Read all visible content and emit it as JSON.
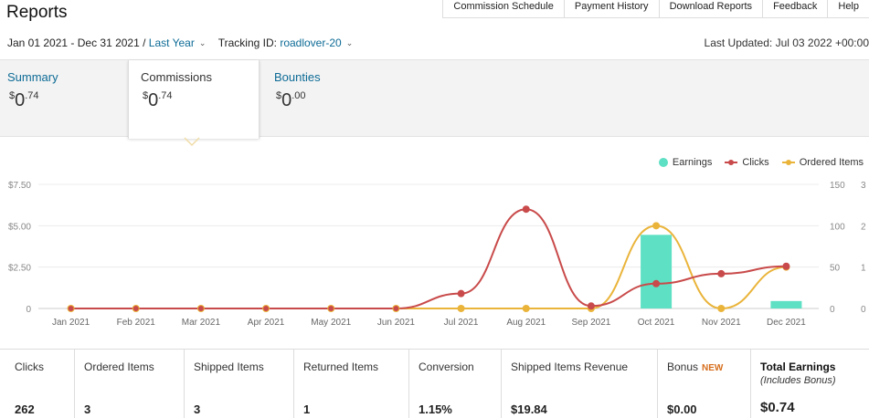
{
  "page": {
    "title": "Reports"
  },
  "topnav": [
    "Commission Schedule",
    "Payment History",
    "Download Reports",
    "Feedback",
    "Help"
  ],
  "filter": {
    "date_range": "Jan 01 2021 - Dec 31 2021 /",
    "preset": "Last Year",
    "tracking_label": "Tracking ID:",
    "tracking_id": "roadlover-20",
    "last_updated": "Last Updated: Jul 03 2022 +00:00"
  },
  "tabs": [
    {
      "label": "Summary",
      "currency": "$",
      "whole": "0",
      "fraction": ".74"
    },
    {
      "label": "Commissions",
      "currency": "$",
      "whole": "0",
      "fraction": ".74"
    },
    {
      "label": "Bounties",
      "currency": "$",
      "whole": "0",
      "fraction": ".00"
    }
  ],
  "legend": {
    "earnings": "Earnings",
    "clicks": "Clicks",
    "ordered": "Ordered Items"
  },
  "colors": {
    "earnings": "#5ee0c4",
    "clicks": "#c94a4a",
    "ordered": "#eab43a",
    "link": "#0d6b96"
  },
  "chart_data": {
    "type": "bar",
    "categories": [
      "Jan 2021",
      "Feb 2021",
      "Mar 2021",
      "Apr 2021",
      "May 2021",
      "Jun 2021",
      "Jul 2021",
      "Aug 2021",
      "Sep 2021",
      "Oct 2021",
      "Nov 2021",
      "Dec 2021"
    ],
    "y_left_ticks": [
      "0",
      "$2.50",
      "$5.00",
      "$7.50"
    ],
    "y_left_range": [
      0,
      7.5
    ],
    "y_right_ticks": [
      "0",
      "50",
      "100",
      "150"
    ],
    "y_right_range": [
      0,
      150
    ],
    "y_right2_ticks": [
      "0",
      "1",
      "2",
      "3"
    ],
    "y_right2_range": [
      0,
      3
    ],
    "series": [
      {
        "name": "Earnings",
        "type": "bar",
        "axis": "left",
        "values": [
          0,
          0,
          0,
          0,
          0,
          0,
          0,
          0,
          0,
          4.45,
          0,
          0.45
        ]
      },
      {
        "name": "Clicks",
        "type": "line",
        "axis": "right",
        "values": [
          0,
          0,
          0,
          0,
          0,
          0,
          18,
          120,
          3,
          30,
          42,
          51
        ]
      },
      {
        "name": "Ordered Items",
        "type": "line",
        "axis": "right2",
        "values": [
          0,
          0,
          0,
          0,
          0,
          0,
          0,
          0,
          0,
          2,
          0,
          1
        ]
      }
    ],
    "grid": true,
    "legend_position": "top-right"
  },
  "stats": [
    {
      "label": "Clicks",
      "value": "262"
    },
    {
      "label": "Ordered Items",
      "value": "3"
    },
    {
      "label": "Shipped Items",
      "value": "3"
    },
    {
      "label": "Returned Items",
      "value": "1"
    },
    {
      "label": "Conversion",
      "value": "1.15%"
    },
    {
      "label": "Shipped Items Revenue",
      "value": "$19.84"
    },
    {
      "label": "Bonus",
      "badge": "NEW",
      "value": "$0.00"
    },
    {
      "label": "Total Earnings",
      "sublabel": "(Includes Bonus)",
      "value": "$0.74"
    }
  ]
}
